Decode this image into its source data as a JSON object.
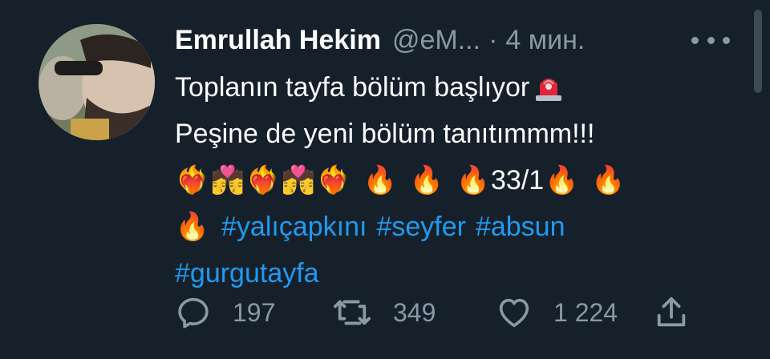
{
  "author": {
    "display_name": "Emrullah Hekim",
    "handle": "@eM...",
    "separator": "·",
    "timestamp": "4 мин."
  },
  "tweet": {
    "line1_text": "Toplanın tayfa bölüm başlıyor",
    "line1_emoji": "siren-icon",
    "line2_text": "Peşine de yeni bölüm tanıtımmm!!!",
    "line3_emojis": [
      "❤️‍🔥",
      "💏",
      "❤️‍🔥",
      "💏",
      "❤️‍🔥",
      "🔥",
      "🔥",
      "🔥"
    ],
    "line3_text": "33/1",
    "line3_trailing_emojis": [
      "🔥",
      "🔥"
    ],
    "line4_leading_emoji": "🔥",
    "hashtags_line4": [
      "#yalıçapkını",
      "#seyfer",
      "#absun"
    ],
    "hashtags_line5": [
      "#gurgutayfa"
    ]
  },
  "actions": {
    "reply_count": "197",
    "retweet_count": "349",
    "like_count": "1 224",
    "icons": [
      "reply-icon",
      "retweet-icon",
      "like-icon",
      "share-icon"
    ]
  },
  "colors": {
    "background": "#15202b",
    "text": "#ffffff",
    "muted": "#8b98a5",
    "hashtag": "#1d9bf0"
  }
}
